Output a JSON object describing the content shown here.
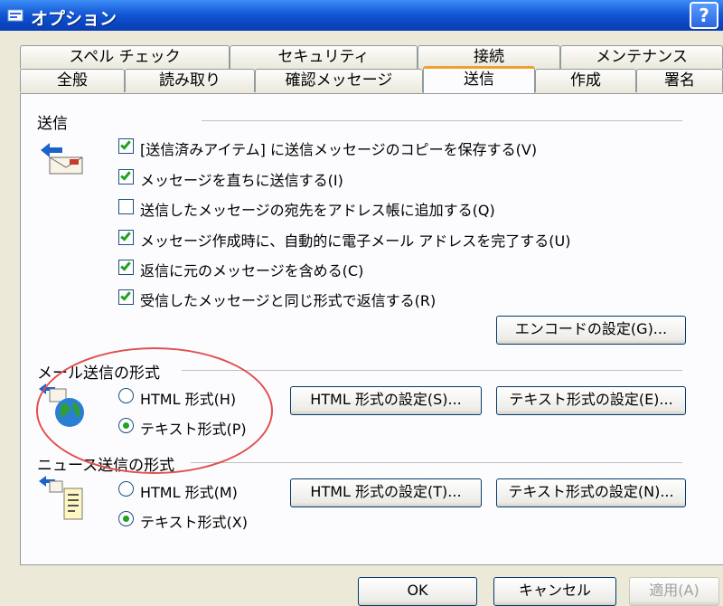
{
  "window": {
    "title": "オプション",
    "help": "?"
  },
  "tabs_back": [
    "スペル チェック",
    "セキュリティ",
    "接続",
    "メンテナンス"
  ],
  "tabs_front": [
    "全般",
    "読み取り",
    "確認メッセージ",
    "送信",
    "作成",
    "署名"
  ],
  "send": {
    "label": "送信",
    "options": [
      {
        "text": "[送信済みアイテム] に送信メッセージのコピーを保存する(V)",
        "checked": true
      },
      {
        "text": "メッセージを直ちに送信する(I)",
        "checked": true
      },
      {
        "text": "送信したメッセージの宛先をアドレス帳に追加する(Q)",
        "checked": false
      },
      {
        "text": "メッセージ作成時に、自動的に電子メール アドレスを完了する(U)",
        "checked": true
      },
      {
        "text": "返信に元のメッセージを含める(C)",
        "checked": true
      },
      {
        "text": "受信したメッセージと同じ形式で返信する(R)",
        "checked": true
      }
    ],
    "encode_button": "エンコードの設定(G)..."
  },
  "mail_format": {
    "label": "メール送信の形式",
    "html_option": "HTML 形式(H)",
    "text_option": "テキスト形式(P)",
    "selected": "text",
    "html_button": "HTML 形式の設定(S)...",
    "text_button": "テキスト形式の設定(E)..."
  },
  "news_format": {
    "label": "ニュース送信の形式",
    "html_option": "HTML 形式(M)",
    "text_option": "テキスト形式(X)",
    "selected": "text",
    "html_button": "HTML 形式の設定(T)...",
    "text_button": "テキスト形式の設定(N)..."
  },
  "footer": {
    "ok": "OK",
    "cancel": "キャンセル",
    "apply": "適用(A)"
  },
  "colors": {
    "titlebar": "#0a46c2",
    "active_tab_accent": "#f0a030",
    "check": "#21a121",
    "annotation": "#e05050"
  }
}
